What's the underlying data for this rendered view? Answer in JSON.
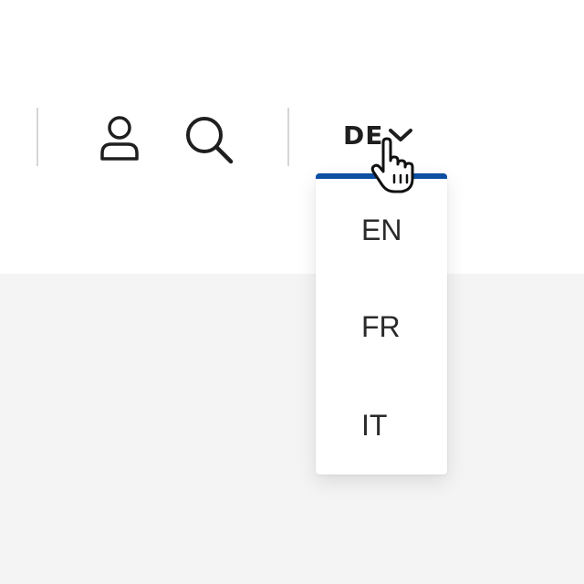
{
  "header": {
    "icons": {
      "account": "user-icon",
      "search": "search-icon",
      "chevron": "chevron-down-icon",
      "cursor": "hand-pointer-icon"
    }
  },
  "language": {
    "current": "DE",
    "options": [
      {
        "label": "EN"
      },
      {
        "label": "FR"
      },
      {
        "label": "IT"
      }
    ]
  },
  "colors": {
    "accent": "#0b4ea2",
    "text": "#1f1f1f",
    "page_background": "#f4f4f4",
    "divider": "#d6d6d6"
  }
}
